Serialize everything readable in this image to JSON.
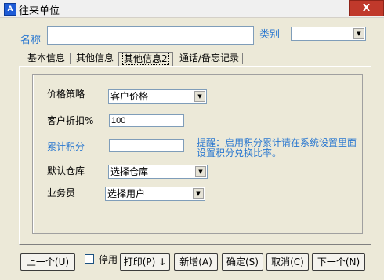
{
  "window": {
    "title": "往来单位",
    "app_icon": "A",
    "close_glyph": "X"
  },
  "top": {
    "name_label": "名称",
    "name_value": "",
    "category_label": "类别",
    "category_value": ""
  },
  "tabs": [
    "基本信息",
    "其他信息",
    "其他信息2",
    "通话/备忘记录"
  ],
  "form": {
    "price_policy_label": "价格策略",
    "price_policy_value": "客户价格",
    "discount_label": "客户折扣%",
    "discount_value": "100",
    "points_label": "累计积分",
    "points_value": "",
    "points_hint": "提醒：启用积分累计请在系统设置里面设置积分兑换比率。",
    "warehouse_label": "默认仓库",
    "warehouse_value": "选择仓库",
    "salesman_label": "业务员",
    "salesman_value": "选择用户"
  },
  "buttons": {
    "prev": "上一个(U)",
    "disable": "停用",
    "print": "打印(P)",
    "print_arrow": "↓",
    "add": "新增(A)",
    "ok": "确定(S)",
    "cancel": "取消(C)",
    "next": "下一个(N)"
  },
  "colors": {
    "link_blue": "#2a78d0",
    "close_red": "#c0392b"
  }
}
